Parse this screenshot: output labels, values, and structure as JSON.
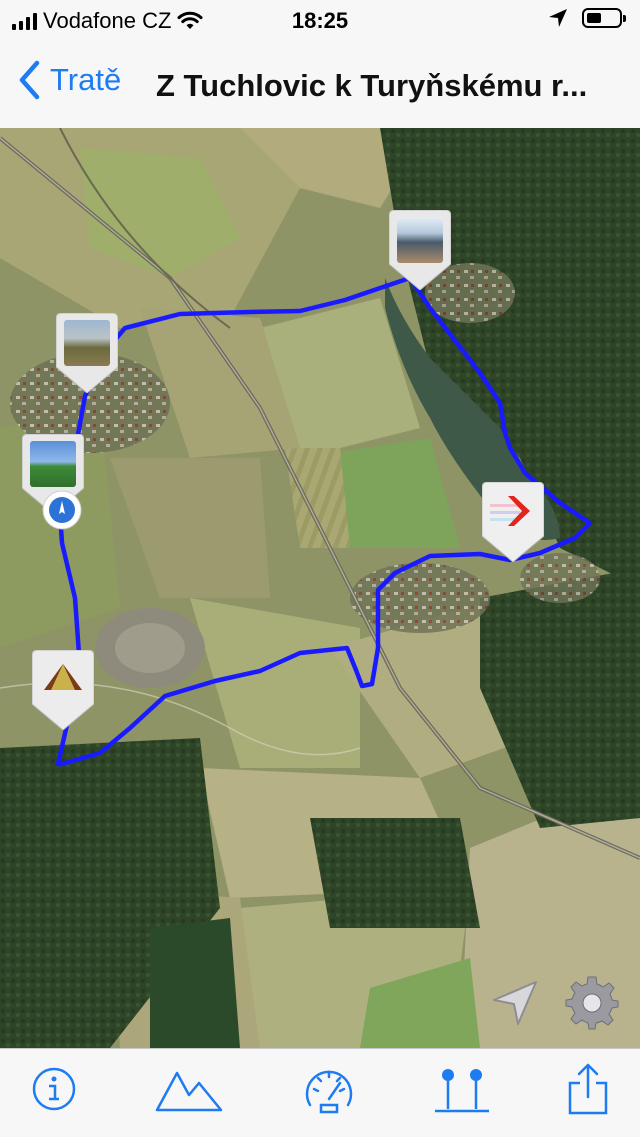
{
  "status_bar": {
    "carrier": "Vodafone CZ",
    "time": "18:25",
    "battery_level": 0.45
  },
  "nav": {
    "back_label": "Tratě",
    "title": "Z Tuchlovic k Turyňskému r..."
  },
  "map": {
    "type": "satellite",
    "route_color": "#1a1aff",
    "pins": [
      {
        "name": "photo-pin-village",
        "icon": "photo-thumbnail"
      },
      {
        "name": "photo-pin-field",
        "icon": "photo-thumbnail"
      },
      {
        "name": "photo-pin-pond",
        "icon": "photo-thumbnail"
      },
      {
        "name": "start-pin",
        "icon": "mountain-triangle-icon"
      },
      {
        "name": "finish-pin",
        "icon": "chevron-right-icon"
      }
    ],
    "controls": [
      "location-arrow-icon",
      "gear-icon"
    ]
  },
  "tab_bar": {
    "accent": "#1e7cf2",
    "items": [
      {
        "name": "info",
        "icon": "info-icon"
      },
      {
        "name": "elevation",
        "icon": "mountain-icon"
      },
      {
        "name": "speed",
        "icon": "speedometer-icon"
      },
      {
        "name": "waypoints",
        "icon": "pins-icon"
      },
      {
        "name": "share",
        "icon": "share-icon"
      }
    ]
  }
}
